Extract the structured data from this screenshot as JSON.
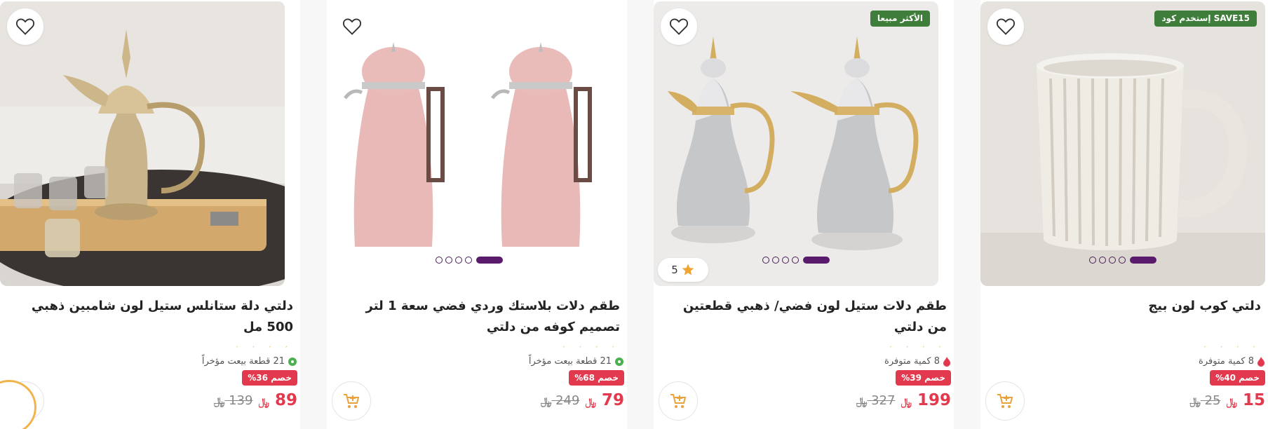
{
  "currency": "﷼",
  "colors": {
    "accent_purple": "#5b1b6c",
    "discount_red": "#e3394e",
    "badge_green": "#3f7d3b",
    "star_orange": "#f0a531"
  },
  "products": [
    {
      "title": "دلتي دلة ستانلس ستيل لون شامبين ذهبي 500 مل",
      "stock_text": "21 قطعة بيعت مؤخراً",
      "stock_icon": "tag-icon",
      "discount": "خصم 36%",
      "price_new": "89",
      "price_old": "139",
      "badge": "",
      "rating": "",
      "image_icon": "gold-dallah-set-image"
    },
    {
      "title": "طقم دلات بلاستك وردي فضي سعة 1 لتر تصميم كوفه من دلتي",
      "stock_text": "21 قطعة بيعت مؤخراً",
      "stock_icon": "tag-icon",
      "discount": "خصم 68%",
      "price_new": "79",
      "price_old": "249",
      "badge": "",
      "rating": "",
      "image_icon": "pink-flasks-image"
    },
    {
      "title": "طقم دلات ستيل لون فضي/ ذهبي قطعتين من دلتي",
      "stock_text": "8 كمية متوفرة",
      "stock_icon": "fire-icon",
      "discount": "خصم 39%",
      "price_new": "199",
      "price_old": "327",
      "badge": "الأكثر مبيعا",
      "rating": "5",
      "image_icon": "silver-gold-dallah-image"
    },
    {
      "title": "دلتي كوب لون بيج",
      "stock_text": "8 كمية متوفرة",
      "stock_icon": "fire-icon",
      "discount": "خصم 40%",
      "price_new": "15",
      "price_old": "25",
      "badge": "إستخدم كود SAVE15",
      "rating": "",
      "image_icon": "beige-mug-image"
    }
  ]
}
